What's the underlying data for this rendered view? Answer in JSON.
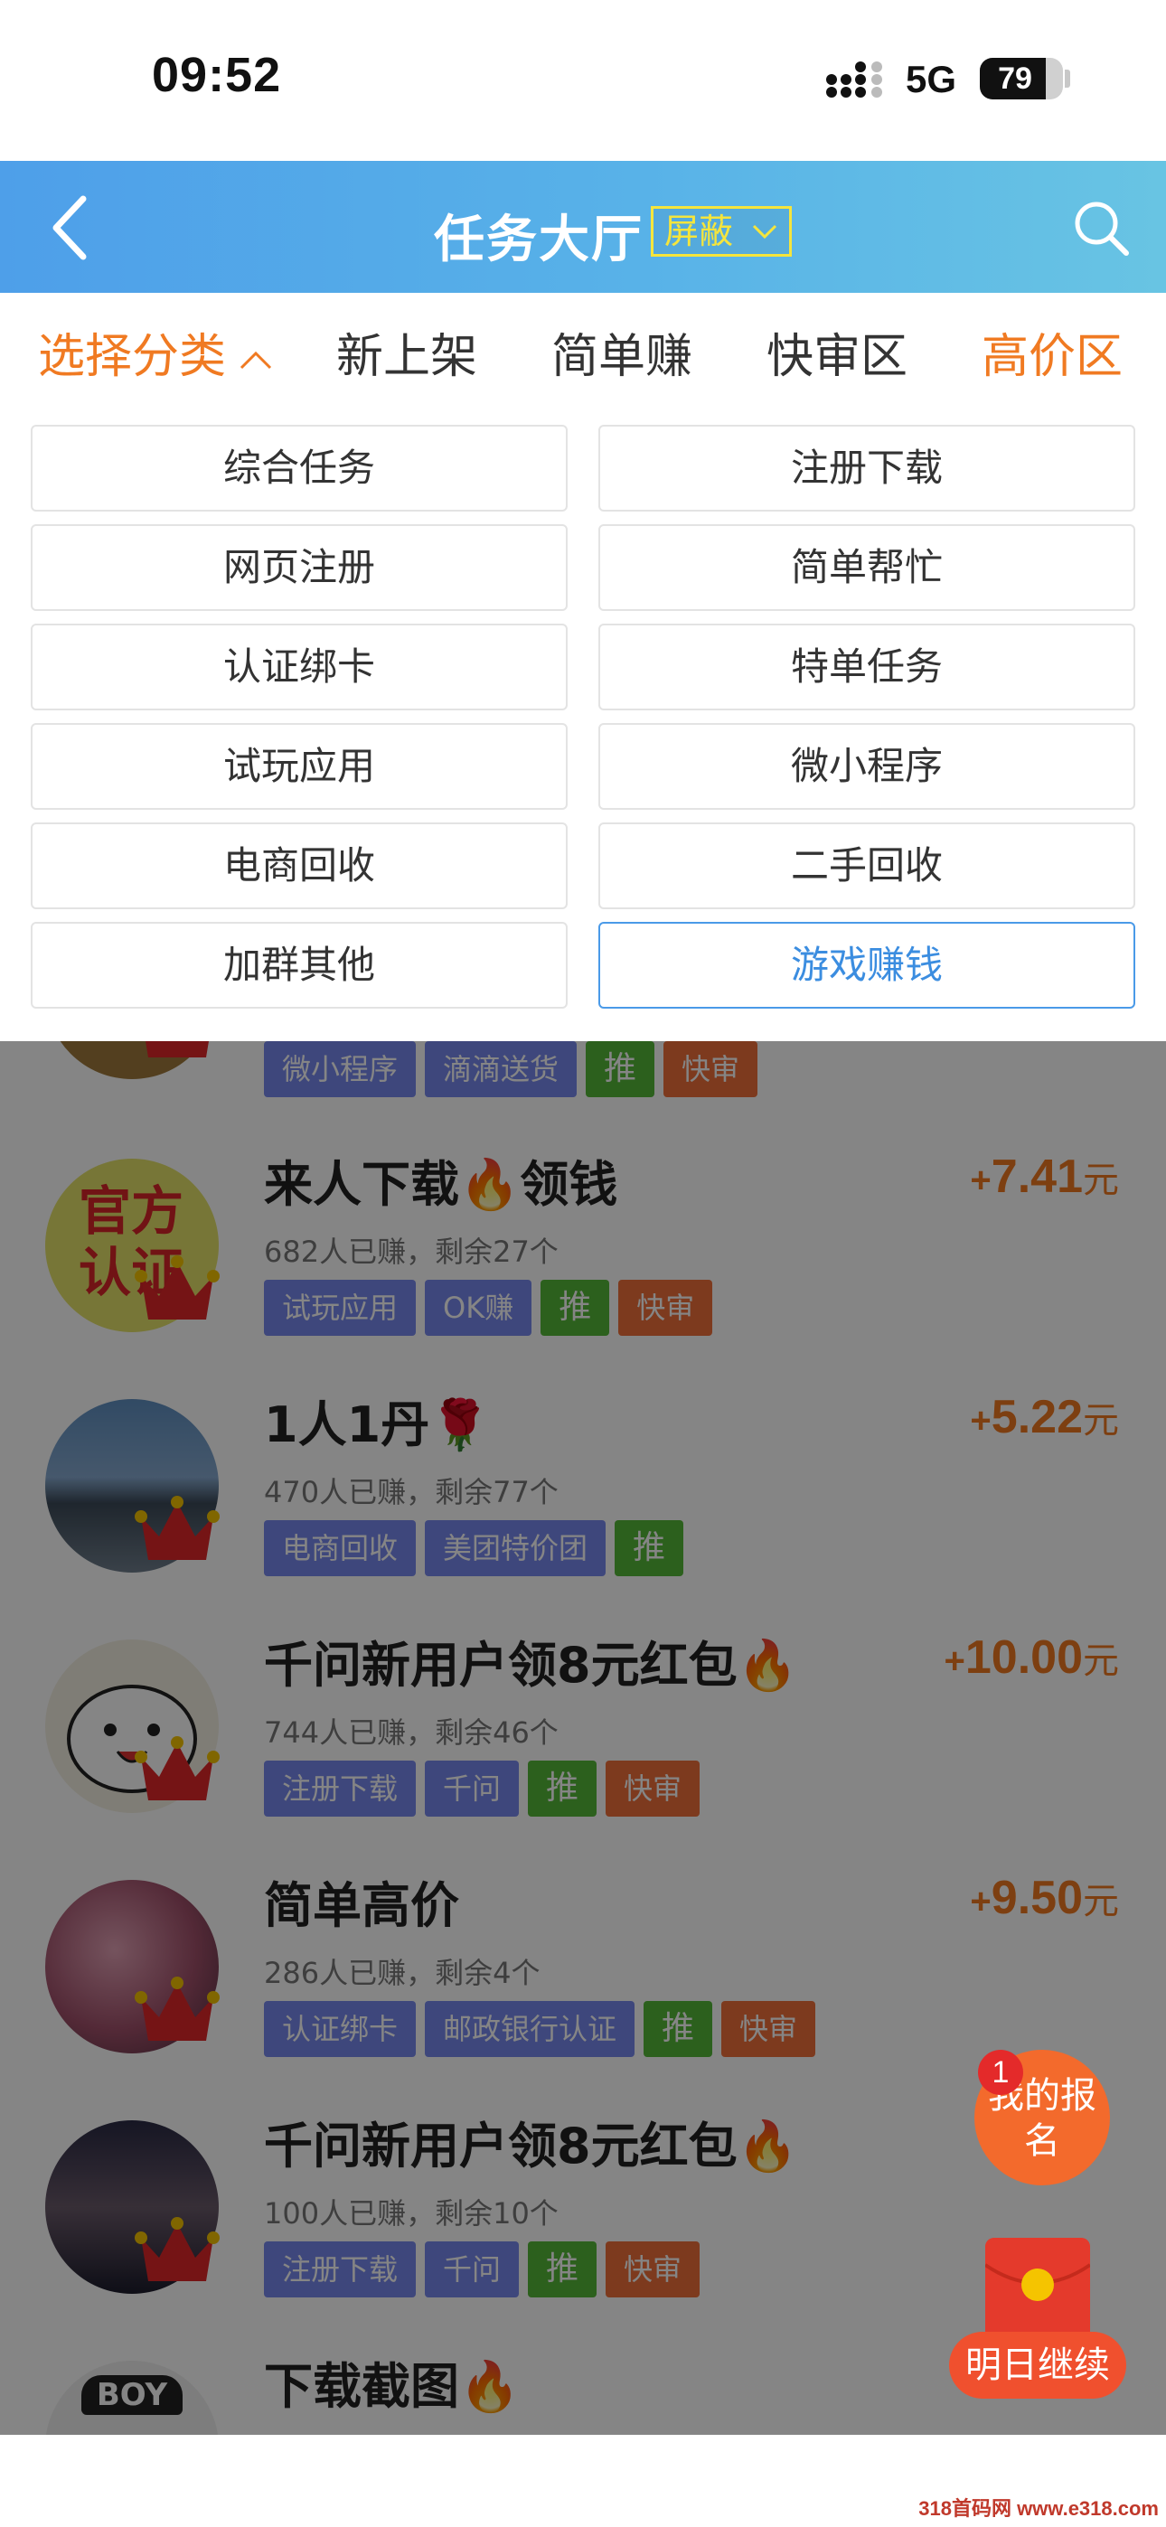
{
  "status": {
    "time": "09:52",
    "network": "5G",
    "battery": "79",
    "battery_level": 0.79
  },
  "header": {
    "title": "任务大厅",
    "filter_label": "屏蔽",
    "icons": {
      "back": "chevron-left-icon",
      "search": "search-icon"
    }
  },
  "tabs": [
    {
      "label": "选择分类"
    },
    {
      "label": "新上架"
    },
    {
      "label": "简单赚"
    },
    {
      "label": "快审区"
    },
    {
      "label": "高价区"
    }
  ],
  "categories": [
    {
      "label": "综合任务"
    },
    {
      "label": "注册下载"
    },
    {
      "label": "网页注册"
    },
    {
      "label": "简单帮忙"
    },
    {
      "label": "认证绑卡"
    },
    {
      "label": "特单任务"
    },
    {
      "label": "试玩应用"
    },
    {
      "label": "微小程序"
    },
    {
      "label": "电商回收"
    },
    {
      "label": "二手回收"
    },
    {
      "label": "加群其他"
    },
    {
      "label": "游戏赚钱"
    }
  ],
  "selected_category": "游戏赚钱",
  "tasks": [
    {
      "title": "",
      "meta": "",
      "price": "",
      "tags": [
        "微小程序",
        "滴滴送货",
        "推",
        "快审"
      ],
      "annual": "年卡"
    },
    {
      "title": "来人下载🔥领钱",
      "meta": "682人已赚，剩余27个",
      "price": "7.41",
      "tags": [
        "试玩应用",
        "OK赚",
        "推",
        "快审"
      ],
      "annual": "年卡",
      "avatar_text": "官方认证"
    },
    {
      "title": "1人1丹🌹",
      "meta": "470人已赚，剩余77个",
      "price": "5.22",
      "tags": [
        "电商回收",
        "美团特价团",
        "推"
      ],
      "annual": "年卡"
    },
    {
      "title": "千问新用户领8元红包🔥",
      "meta": "744人已赚，剩余46个",
      "price": "10.00",
      "tags": [
        "注册下载",
        "千问",
        "推",
        "快审"
      ],
      "annual": "年卡"
    },
    {
      "title": "简单高价",
      "meta": "286人已赚，剩余4个",
      "price": "9.50",
      "tags": [
        "认证绑卡",
        "邮政银行认证",
        "推",
        "快审"
      ],
      "annual": "年卡"
    },
    {
      "title": "千问新用户领8元红包🔥",
      "meta": "100人已赚，剩余10个",
      "price": "",
      "tags": [
        "注册下载",
        "千问",
        "推",
        "快审"
      ],
      "annual": "年卡"
    },
    {
      "title": "下载截图🔥",
      "meta": "",
      "price": "",
      "tags": [],
      "avatar_text": "BOY"
    }
  ],
  "currency": "元",
  "plus": "+",
  "float": {
    "badge": "1",
    "signup": "我的报名",
    "redpack": "明日继续"
  },
  "watermark": "318首码网 www.e318.com"
}
